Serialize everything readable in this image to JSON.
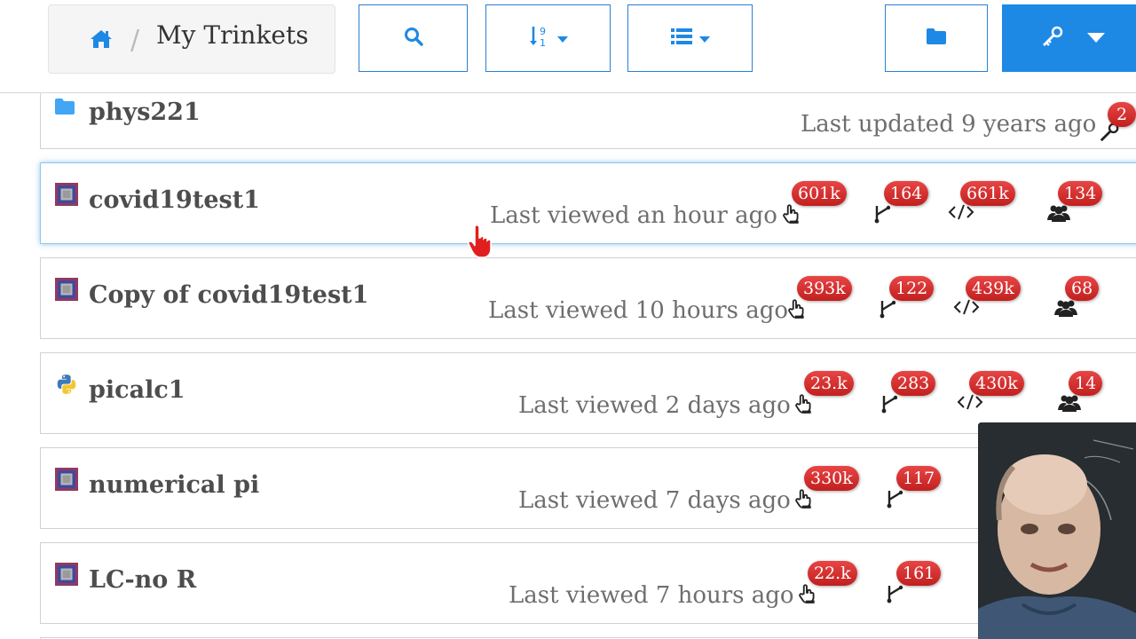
{
  "header": {
    "breadcrumb_title": "My Trinkets",
    "breadcrumb_separator": "/",
    "home_icon": "home-icon",
    "buttons": [
      {
        "name": "search-button",
        "icon": "search-icon"
      },
      {
        "name": "sort-button",
        "icon": "sort-numeric-icon"
      },
      {
        "name": "view-button",
        "icon": "list-icon"
      },
      {
        "name": "folder-button",
        "icon": "folder-icon"
      },
      {
        "name": "key-menu-button",
        "icon": "key-icon"
      }
    ]
  },
  "colors": {
    "accent": "#1e88e5",
    "badge": "#d32f2f",
    "folder": "#42a5f5",
    "trinket_icon": "#8e3a63"
  },
  "folder_row": {
    "name": "phys221",
    "meta": "Last updated 9 years ago",
    "badge": "2"
  },
  "trinkets": [
    {
      "name": "covid19test1",
      "meta": "Last viewed an hour ago",
      "type_icon": "glowscript-icon",
      "views": "601k",
      "runs": "164",
      "codes": "661k",
      "users": "134"
    },
    {
      "name": "Copy of covid19test1",
      "meta": "Last viewed 10 hours ago",
      "type_icon": "glowscript-icon",
      "views": "393k",
      "runs": "122",
      "codes": "439k",
      "users": "68"
    },
    {
      "name": "picalc1",
      "meta": "Last viewed 2 days ago",
      "type_icon": "python-icon",
      "views": "23.k",
      "runs": "283",
      "codes": "430k",
      "users": "14"
    },
    {
      "name": "numerical pi",
      "meta": "Last viewed 7 days ago",
      "type_icon": "glowscript-icon",
      "views": "330k",
      "runs": "117"
    },
    {
      "name": "LC-no R",
      "meta": "Last viewed 7 hours ago",
      "type_icon": "glowscript-icon",
      "views": "22.k",
      "runs": "161"
    }
  ]
}
